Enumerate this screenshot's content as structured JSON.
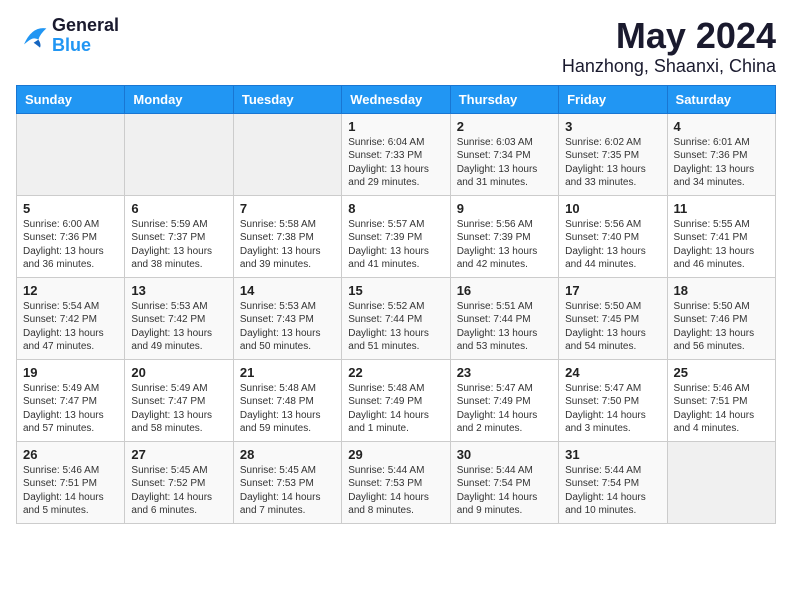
{
  "logo": {
    "text_general": "General",
    "text_blue": "Blue"
  },
  "header": {
    "month": "May 2024",
    "location": "Hanzhong, Shaanxi, China"
  },
  "days_of_week": [
    "Sunday",
    "Monday",
    "Tuesday",
    "Wednesday",
    "Thursday",
    "Friday",
    "Saturday"
  ],
  "weeks": [
    [
      {
        "day": "",
        "info": ""
      },
      {
        "day": "",
        "info": ""
      },
      {
        "day": "",
        "info": ""
      },
      {
        "day": "1",
        "info": "Sunrise: 6:04 AM\nSunset: 7:33 PM\nDaylight: 13 hours\nand 29 minutes."
      },
      {
        "day": "2",
        "info": "Sunrise: 6:03 AM\nSunset: 7:34 PM\nDaylight: 13 hours\nand 31 minutes."
      },
      {
        "day": "3",
        "info": "Sunrise: 6:02 AM\nSunset: 7:35 PM\nDaylight: 13 hours\nand 33 minutes."
      },
      {
        "day": "4",
        "info": "Sunrise: 6:01 AM\nSunset: 7:36 PM\nDaylight: 13 hours\nand 34 minutes."
      }
    ],
    [
      {
        "day": "5",
        "info": "Sunrise: 6:00 AM\nSunset: 7:36 PM\nDaylight: 13 hours\nand 36 minutes."
      },
      {
        "day": "6",
        "info": "Sunrise: 5:59 AM\nSunset: 7:37 PM\nDaylight: 13 hours\nand 38 minutes."
      },
      {
        "day": "7",
        "info": "Sunrise: 5:58 AM\nSunset: 7:38 PM\nDaylight: 13 hours\nand 39 minutes."
      },
      {
        "day": "8",
        "info": "Sunrise: 5:57 AM\nSunset: 7:39 PM\nDaylight: 13 hours\nand 41 minutes."
      },
      {
        "day": "9",
        "info": "Sunrise: 5:56 AM\nSunset: 7:39 PM\nDaylight: 13 hours\nand 42 minutes."
      },
      {
        "day": "10",
        "info": "Sunrise: 5:56 AM\nSunset: 7:40 PM\nDaylight: 13 hours\nand 44 minutes."
      },
      {
        "day": "11",
        "info": "Sunrise: 5:55 AM\nSunset: 7:41 PM\nDaylight: 13 hours\nand 46 minutes."
      }
    ],
    [
      {
        "day": "12",
        "info": "Sunrise: 5:54 AM\nSunset: 7:42 PM\nDaylight: 13 hours\nand 47 minutes."
      },
      {
        "day": "13",
        "info": "Sunrise: 5:53 AM\nSunset: 7:42 PM\nDaylight: 13 hours\nand 49 minutes."
      },
      {
        "day": "14",
        "info": "Sunrise: 5:53 AM\nSunset: 7:43 PM\nDaylight: 13 hours\nand 50 minutes."
      },
      {
        "day": "15",
        "info": "Sunrise: 5:52 AM\nSunset: 7:44 PM\nDaylight: 13 hours\nand 51 minutes."
      },
      {
        "day": "16",
        "info": "Sunrise: 5:51 AM\nSunset: 7:44 PM\nDaylight: 13 hours\nand 53 minutes."
      },
      {
        "day": "17",
        "info": "Sunrise: 5:50 AM\nSunset: 7:45 PM\nDaylight: 13 hours\nand 54 minutes."
      },
      {
        "day": "18",
        "info": "Sunrise: 5:50 AM\nSunset: 7:46 PM\nDaylight: 13 hours\nand 56 minutes."
      }
    ],
    [
      {
        "day": "19",
        "info": "Sunrise: 5:49 AM\nSunset: 7:47 PM\nDaylight: 13 hours\nand 57 minutes."
      },
      {
        "day": "20",
        "info": "Sunrise: 5:49 AM\nSunset: 7:47 PM\nDaylight: 13 hours\nand 58 minutes."
      },
      {
        "day": "21",
        "info": "Sunrise: 5:48 AM\nSunset: 7:48 PM\nDaylight: 13 hours\nand 59 minutes."
      },
      {
        "day": "22",
        "info": "Sunrise: 5:48 AM\nSunset: 7:49 PM\nDaylight: 14 hours\nand 1 minute."
      },
      {
        "day": "23",
        "info": "Sunrise: 5:47 AM\nSunset: 7:49 PM\nDaylight: 14 hours\nand 2 minutes."
      },
      {
        "day": "24",
        "info": "Sunrise: 5:47 AM\nSunset: 7:50 PM\nDaylight: 14 hours\nand 3 minutes."
      },
      {
        "day": "25",
        "info": "Sunrise: 5:46 AM\nSunset: 7:51 PM\nDaylight: 14 hours\nand 4 minutes."
      }
    ],
    [
      {
        "day": "26",
        "info": "Sunrise: 5:46 AM\nSunset: 7:51 PM\nDaylight: 14 hours\nand 5 minutes."
      },
      {
        "day": "27",
        "info": "Sunrise: 5:45 AM\nSunset: 7:52 PM\nDaylight: 14 hours\nand 6 minutes."
      },
      {
        "day": "28",
        "info": "Sunrise: 5:45 AM\nSunset: 7:53 PM\nDaylight: 14 hours\nand 7 minutes."
      },
      {
        "day": "29",
        "info": "Sunrise: 5:44 AM\nSunset: 7:53 PM\nDaylight: 14 hours\nand 8 minutes."
      },
      {
        "day": "30",
        "info": "Sunrise: 5:44 AM\nSunset: 7:54 PM\nDaylight: 14 hours\nand 9 minutes."
      },
      {
        "day": "31",
        "info": "Sunrise: 5:44 AM\nSunset: 7:54 PM\nDaylight: 14 hours\nand 10 minutes."
      },
      {
        "day": "",
        "info": ""
      }
    ]
  ]
}
